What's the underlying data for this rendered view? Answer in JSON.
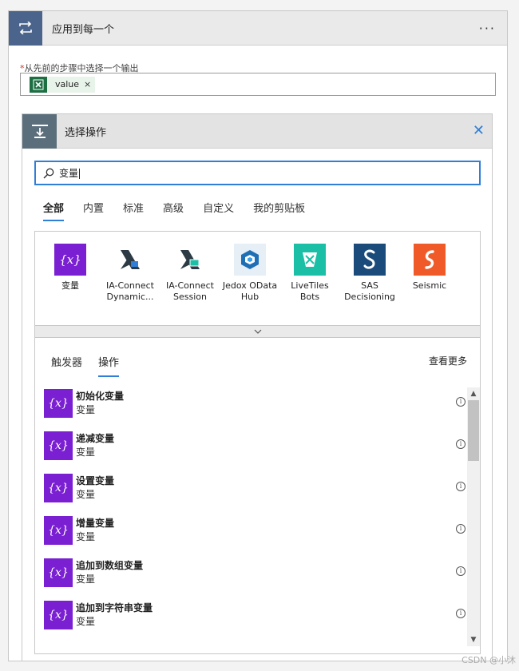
{
  "header": {
    "title": "应用到每一个",
    "more": "···"
  },
  "field": {
    "required_mark": "*",
    "label": "从先前的步骤中选择一个输出",
    "token_value": "value",
    "token_remove": "×"
  },
  "panel": {
    "title": "选择操作",
    "close": "✕"
  },
  "search": {
    "value": "变量"
  },
  "tabs": [
    {
      "label": "全部",
      "active": true
    },
    {
      "label": "内置"
    },
    {
      "label": "标准"
    },
    {
      "label": "高级"
    },
    {
      "label": "自定义"
    },
    {
      "label": "我的剪贴板"
    }
  ],
  "connectors": [
    {
      "line1": "变量",
      "line2": "",
      "color": "#7a1fd1"
    },
    {
      "line1": "IA-Connect",
      "line2": "Dynamic...",
      "color": "#ffffff"
    },
    {
      "line1": "IA-Connect",
      "line2": "Session",
      "color": "#ffffff"
    },
    {
      "line1": "Jedox OData",
      "line2": "Hub",
      "color": "#e6eef6"
    },
    {
      "line1": "LiveTiles",
      "line2": "Bots",
      "color": "#1bbfa6"
    },
    {
      "line1": "SAS",
      "line2": "Decisioning",
      "color": "#1a4b7a"
    },
    {
      "line1": "Seismic",
      "line2": "",
      "color": "#f05a28"
    }
  ],
  "sub_tabs": [
    {
      "label": "触发器"
    },
    {
      "label": "操作",
      "active": true
    }
  ],
  "see_more": "查看更多",
  "actions": [
    {
      "title": "初始化变量",
      "sub": "变量"
    },
    {
      "title": "递减变量",
      "sub": "变量"
    },
    {
      "title": "设置变量",
      "sub": "变量"
    },
    {
      "title": "增量变量",
      "sub": "变量"
    },
    {
      "title": "追加到数组变量",
      "sub": "变量"
    },
    {
      "title": "追加到字符串变量",
      "sub": "变量"
    }
  ],
  "var_icon_text": "{x}",
  "watermark": "CSDN @小沐"
}
